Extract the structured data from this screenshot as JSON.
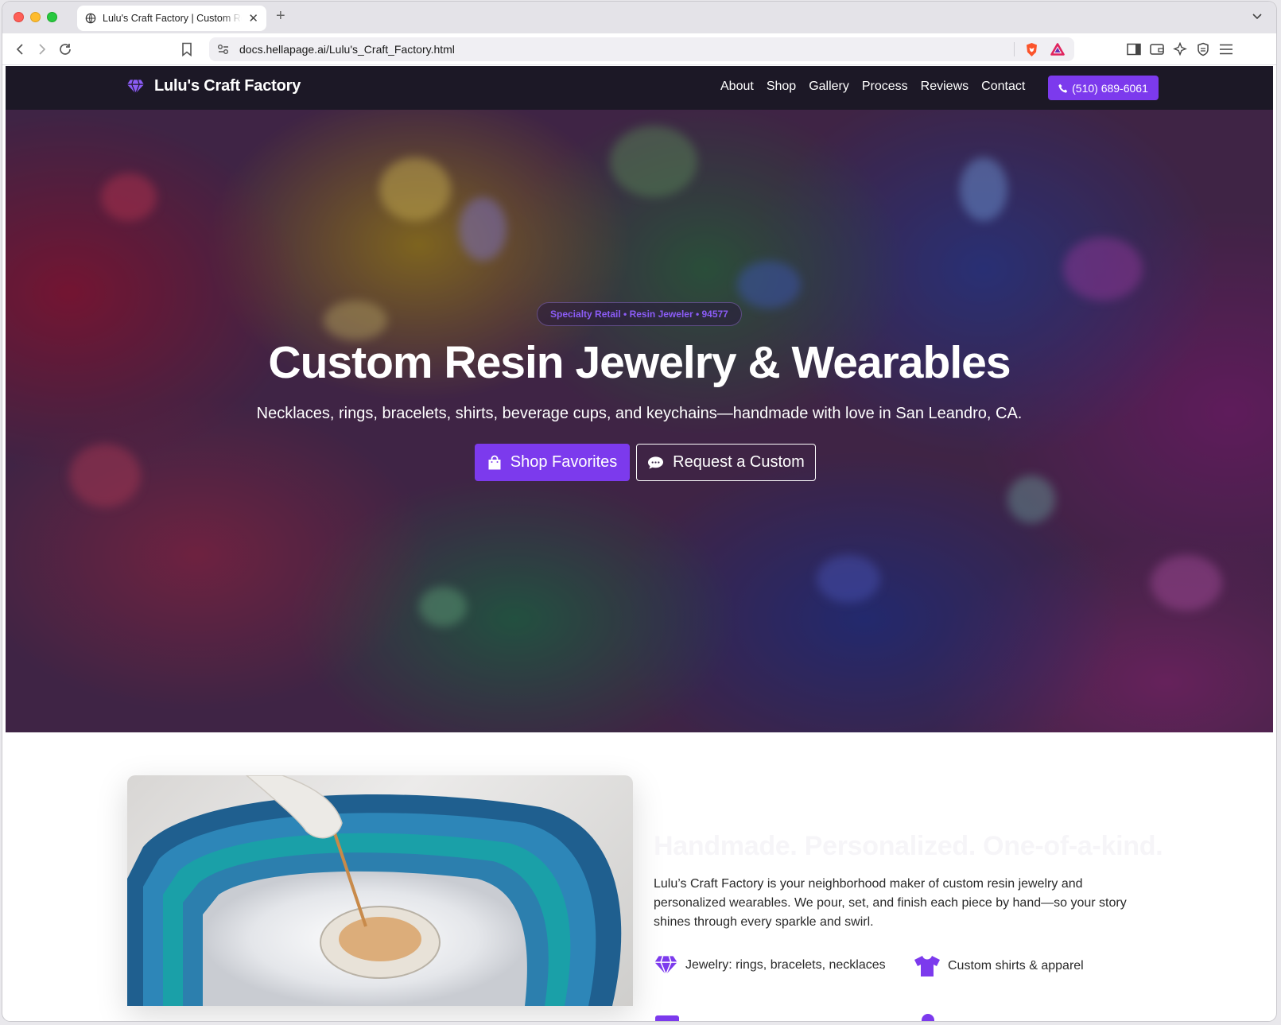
{
  "browser": {
    "tab_title": "Lulu's Craft Factory | Custom Resin Jewelry",
    "new_tab": "+",
    "close": "✕",
    "url_host": "docs.hellapage.ai/",
    "url_path": "Lulu's_Craft_Factory.html"
  },
  "nav": {
    "brand": "Lulu's Craft Factory",
    "links": [
      "About",
      "Shop",
      "Gallery",
      "Process",
      "Reviews",
      "Contact"
    ],
    "phone": "(510) 689-6061"
  },
  "hero": {
    "badge": "Specialty Retail • Resin Jeweler • 94577",
    "title": "Custom Resin Jewelry & Wearables",
    "subtitle": "Necklaces, rings, bracelets, shirts, beverage cups, and keychains—handmade with love in San Leandro, CA.",
    "primary_button": "Shop Favorites",
    "secondary_button": "Request a Custom"
  },
  "about": {
    "heading": "Handmade. Personalized. One-of-a-kind.",
    "text": "Lulu’s Craft Factory is your neighborhood maker of custom resin jewelry and personalized wearables. We pour, set, and finish each piece by hand—so your story shines through every sparkle and swirl.",
    "features": [
      "Jewelry: rings, bracelets, necklaces",
      "Custom shirts & apparel"
    ]
  },
  "colors": {
    "accent": "#7c3aed",
    "nav_bg": "#1c1826"
  }
}
